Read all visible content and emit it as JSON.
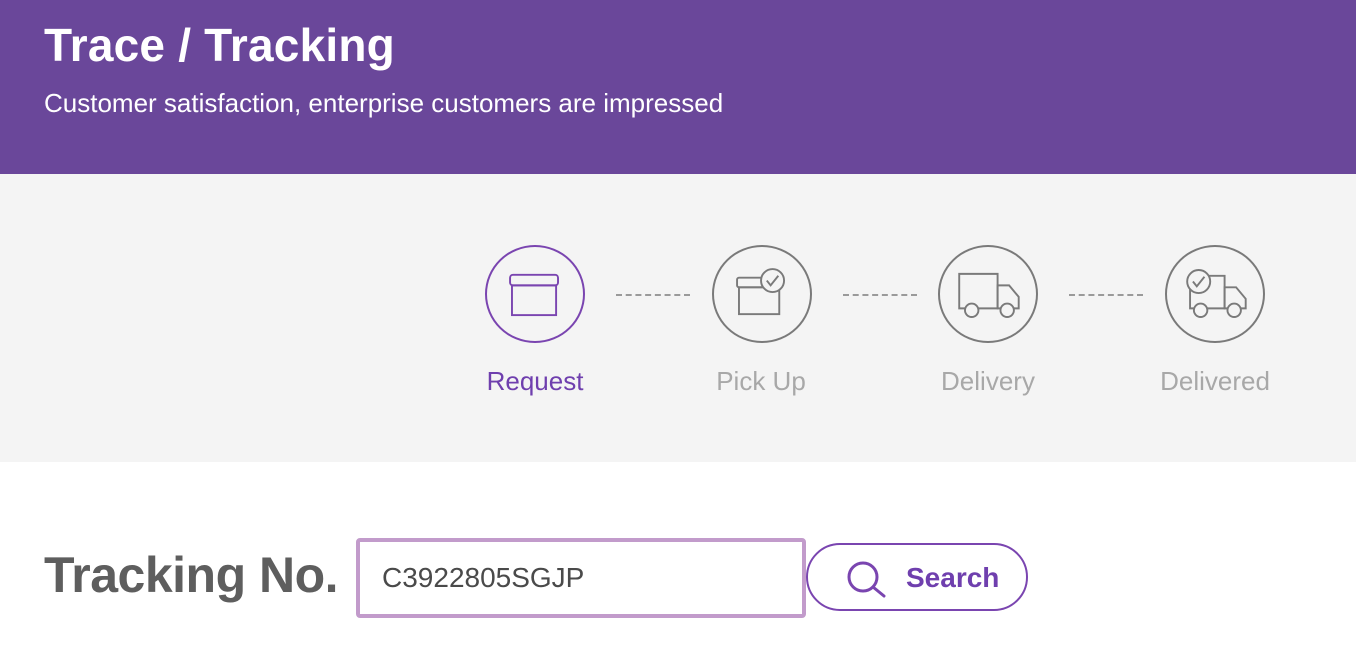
{
  "header": {
    "title": "Trace / Tracking",
    "subtitle": "Customer satisfaction, enterprise customers are impressed",
    "background_color": "#6a479a"
  },
  "steps": [
    {
      "label": "Request",
      "icon": "box-icon",
      "active": true
    },
    {
      "label": "Pick Up",
      "icon": "box-check-icon",
      "active": false
    },
    {
      "label": "Delivery",
      "icon": "truck-icon",
      "active": false
    },
    {
      "label": "Delivered",
      "icon": "truck-check-icon",
      "active": false
    }
  ],
  "colors": {
    "accent": "#6f3fae",
    "inactive": "#a8a8a8",
    "input_border": "#c29bcb"
  },
  "tracking": {
    "label": "Tracking No.",
    "value": "C3922805SGJP",
    "search_label": "Search",
    "search_icon": "search-icon"
  }
}
